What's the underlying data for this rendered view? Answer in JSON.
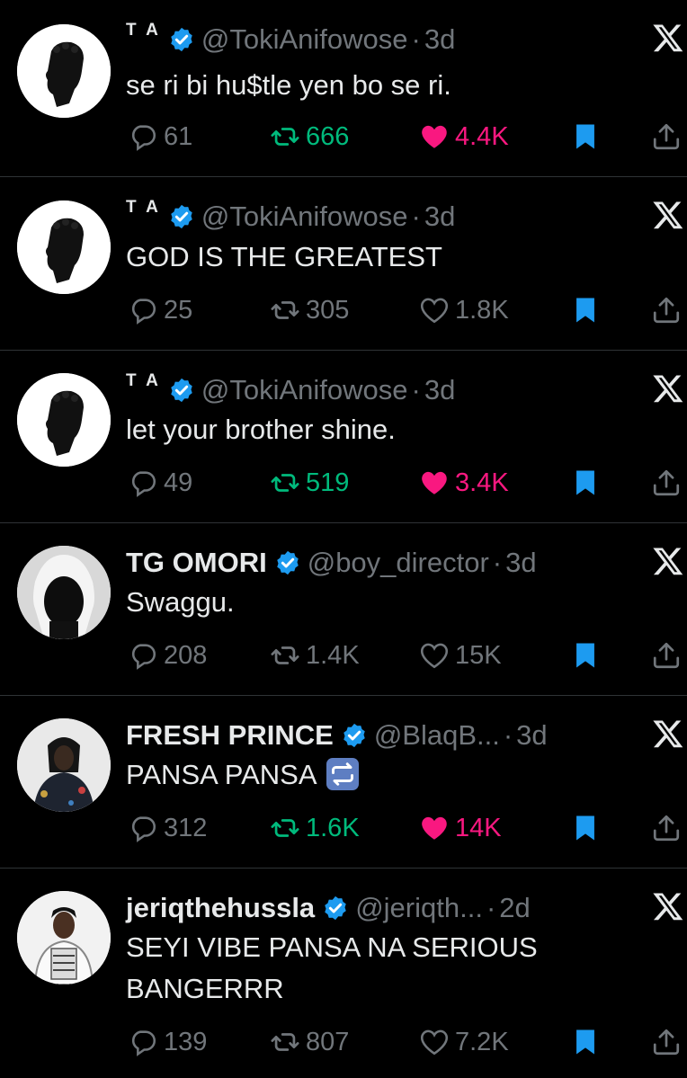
{
  "colors": {
    "background": "#000000",
    "text": "#e7e9ea",
    "muted": "#71767b",
    "verified": "#1d9bf0",
    "retweet_active": "#00ba7c",
    "like_active": "#f91880",
    "bookmark": "#1d9bf0",
    "divider": "#2f3336"
  },
  "tweets": [
    {
      "name": "T A",
      "handle": "@TokiAnifowose",
      "time": "3d",
      "text": [
        "se ri bi hu$tle yen bo se ri."
      ],
      "replies": "61",
      "retweets": "666",
      "likes": "4.4K",
      "retweeted": true,
      "liked": true,
      "bookmarked": true
    },
    {
      "name": "T A",
      "handle": "@TokiAnifowose",
      "time": "3d",
      "text": [
        "GOD IS THE GREATEST"
      ],
      "replies": "25",
      "retweets": "305",
      "likes": "1.8K",
      "retweeted": false,
      "liked": false,
      "bookmarked": true
    },
    {
      "name": "T A",
      "handle": "@TokiAnifowose",
      "time": "3d",
      "text": [
        "let your brother shine."
      ],
      "replies": "49",
      "retweets": "519",
      "likes": "3.4K",
      "retweeted": true,
      "liked": true,
      "bookmarked": true
    },
    {
      "name": "TG OMORI",
      "handle": "@boy_director",
      "time": "3d",
      "text": [
        "Swaggu."
      ],
      "replies": "208",
      "retweets": "1.4K",
      "likes": "15K",
      "retweeted": false,
      "liked": false,
      "bookmarked": true
    },
    {
      "name": "FRESH PRINCE",
      "handle": "@BlaqB...",
      "time": "3d",
      "text": [
        "PANSA PANSA"
      ],
      "emoji": "repeat-button-emoji",
      "replies": "312",
      "retweets": "1.6K",
      "likes": "14K",
      "retweeted": true,
      "liked": true,
      "bookmarked": true
    },
    {
      "name": "jeriqthehussla",
      "handle": "@jeriqth...",
      "time": "2d",
      "text": [
        "SEYI VIBE PANSA NA SERIOUS",
        "BANGERRR"
      ],
      "replies": "139",
      "retweets": "807",
      "likes": "7.2K",
      "retweeted": false,
      "liked": false,
      "bookmarked": true
    }
  ],
  "icons": {
    "verified": "verified-badge-icon",
    "platform": "x-logo-icon",
    "reply": "reply-icon",
    "retweet": "retweet-icon",
    "like": "heart-icon",
    "bookmark": "bookmark-icon",
    "share": "share-icon"
  }
}
